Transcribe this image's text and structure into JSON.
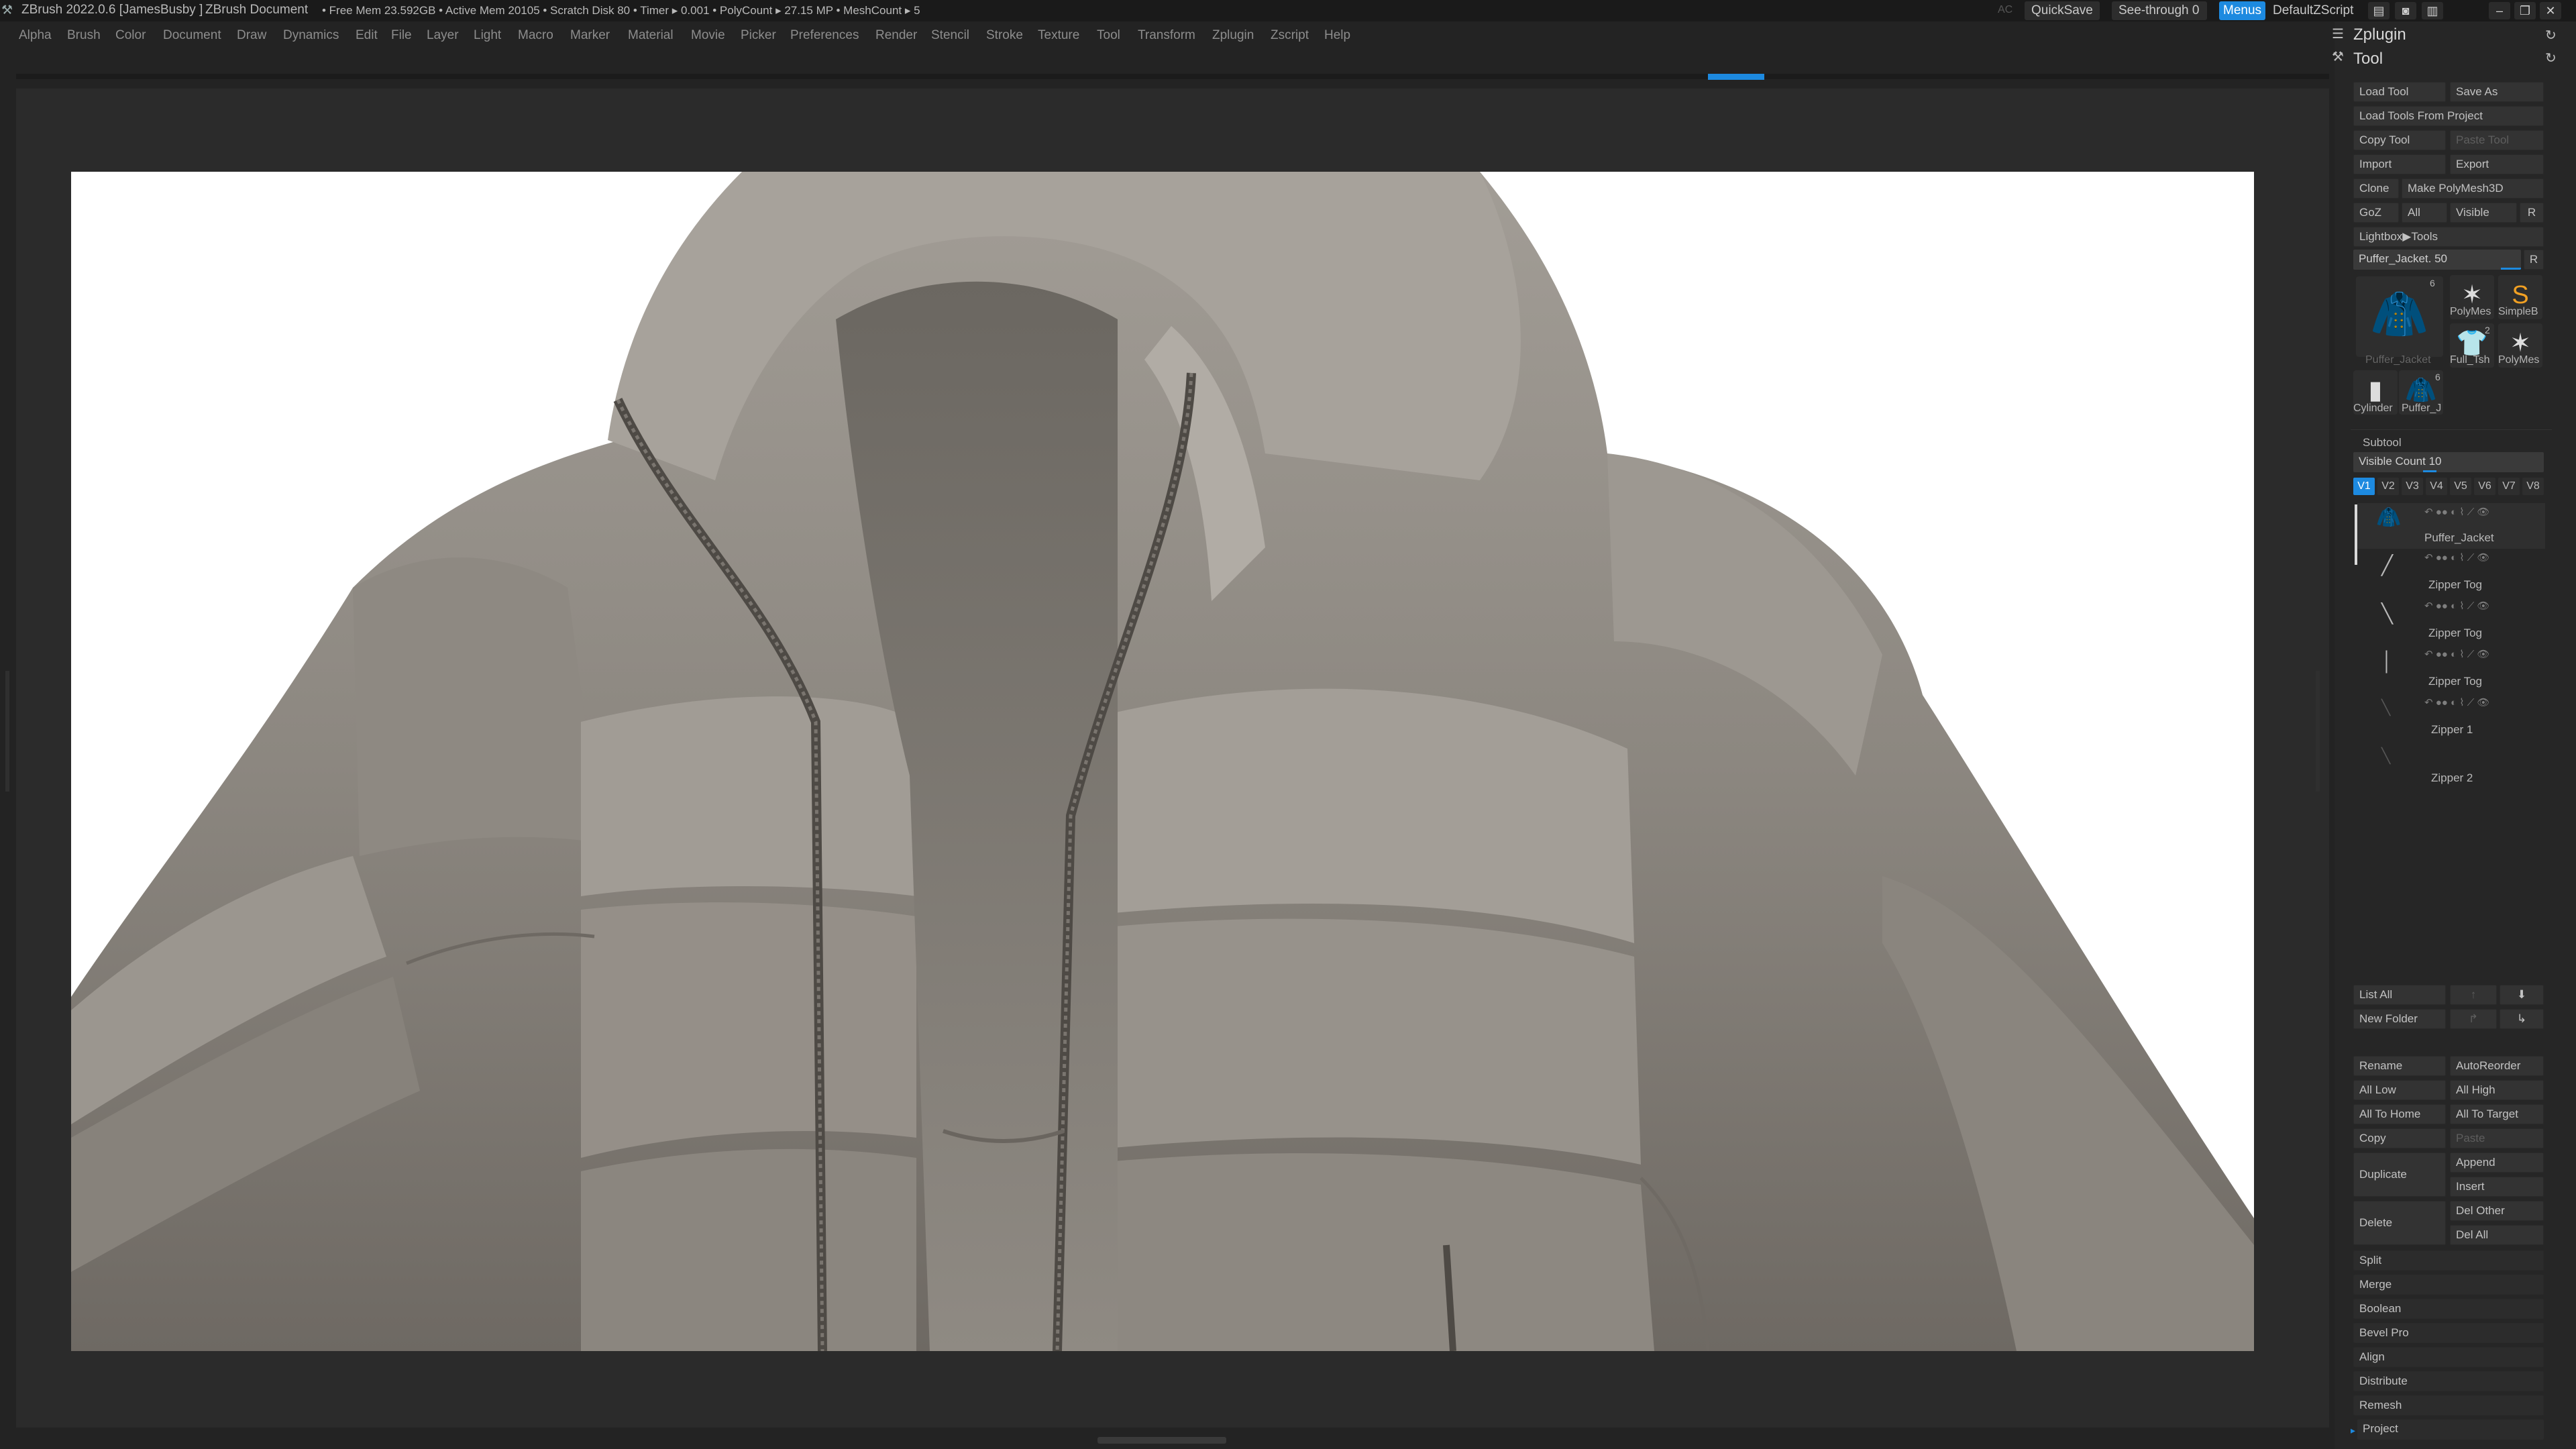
{
  "title_bar": {
    "app": "ZBrush 2022.0.6 [JamesBusby ]",
    "document": "ZBrush Document",
    "stats": "• Free Mem 23.592GB • Active Mem 20105 • Scratch Disk 80 • Timer ▸ 0.001 • PolyCount ▸ 27.15 MP • MeshCount ▸ 5",
    "ac": "AC",
    "quicksave": "QuickSave",
    "see_through": "See-through  0",
    "menus": "Menus",
    "default_zscript": "DefaultZScript"
  },
  "menu_bar": [
    "Alpha",
    "Brush",
    "Color",
    "Document",
    "Draw",
    "Dynamics",
    "Edit",
    "File",
    "Layer",
    "Light",
    "Macro",
    "Marker",
    "Material",
    "Movie",
    "Picker",
    "Preferences",
    "Render",
    "Stencil",
    "Stroke",
    "Texture",
    "Tool",
    "Transform",
    "Zplugin",
    "Zscript",
    "Help"
  ],
  "tray": {
    "zplugin": "Zplugin",
    "tool": "Tool",
    "buttons": {
      "load_tool": "Load Tool",
      "save_as": "Save As",
      "load_from_project": "Load Tools From Project",
      "copy_tool": "Copy Tool",
      "paste_tool": "Paste Tool",
      "import": "Import",
      "export": "Export",
      "clone": "Clone",
      "make_polymesh": "Make PolyMesh3D",
      "goz": "GoZ",
      "all": "All",
      "visible": "Visible",
      "r": "R",
      "lightbox_tools": "Lightbox▶Tools"
    },
    "tool_slider": {
      "label": "Puffer_Jacket. 50",
      "r": "R"
    },
    "thumbnails": {
      "main": "Puffer_Jacket",
      "main_count": "6",
      "polymesh1": "PolyMes",
      "simple": "SimpleB",
      "full": "Full_Tsh",
      "polymesh2": "PolyMes",
      "cylinder": "Cylinder",
      "puffer_small": "Puffer_J",
      "puffer_small_count": "6",
      "full_count": "2"
    },
    "subtool": {
      "header": "Subtool",
      "visible_count": "Visible Count 10",
      "visible_count_value": 10,
      "tabs": [
        "V1",
        "V2",
        "V3",
        "V4",
        "V5",
        "V6",
        "V7",
        "V8"
      ],
      "items": [
        "Puffer_Jacket",
        "Zipper Tog",
        "Zipper Tog",
        "Zipper Tog",
        "Zipper 1",
        "Zipper 2"
      ]
    },
    "list_all": "List All",
    "new_folder": "New Folder",
    "actions": {
      "rename": "Rename",
      "autoreorder": "AutoReorder",
      "all_low": "All Low",
      "all_high": "All High",
      "all_to_home": "All To Home",
      "all_to_target": "All To Target",
      "copy": "Copy",
      "paste": "Paste",
      "duplicate": "Duplicate",
      "append": "Append",
      "insert": "Insert",
      "delete": "Delete",
      "del_other": "Del Other",
      "del_all": "Del All"
    },
    "sections": [
      "Split",
      "Merge",
      "Boolean",
      "Bevel Pro",
      "Align",
      "Distribute",
      "Remesh",
      "Project"
    ]
  },
  "colors": {
    "accent": "#1d8ae0",
    "background": "#232323",
    "canvas": "#ffffff",
    "jacket": "#8c8780"
  }
}
